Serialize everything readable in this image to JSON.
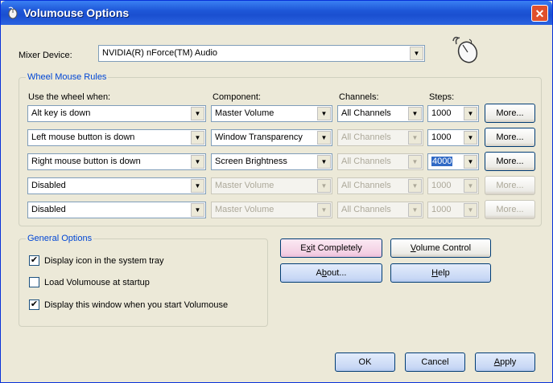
{
  "window": {
    "title": "Volumouse Options",
    "close_label": "✕"
  },
  "mixer": {
    "label": "Mixer Device:",
    "value": "NVIDIA(R) nForce(TM) Audio"
  },
  "rules": {
    "group_title": "Wheel Mouse Rules",
    "headers": {
      "when": "Use the wheel when:",
      "component": "Component:",
      "channels": "Channels:",
      "steps": "Steps:"
    },
    "rows": [
      {
        "when": "Alt key is down",
        "component": "Master Volume",
        "channels": "All Channels",
        "steps": "1000",
        "more": "More..."
      },
      {
        "when": "Left mouse button is down",
        "component": "Window Transparency",
        "channels": "All Channels",
        "steps": "1000",
        "more": "More..."
      },
      {
        "when": "Right mouse button is down",
        "component": "Screen Brightness",
        "channels": "All Channels",
        "steps": "4000",
        "more": "More..."
      },
      {
        "when": "Disabled",
        "component": "Master Volume",
        "channels": "All Channels",
        "steps": "1000",
        "more": "More..."
      },
      {
        "when": "Disabled",
        "component": "Master Volume",
        "channels": "All Channels",
        "steps": "1000",
        "more": "More..."
      }
    ]
  },
  "general": {
    "group_title": "General Options",
    "options": [
      {
        "label": "Display icon in the system tray",
        "checked": true
      },
      {
        "label": "Load Volumouse at startup",
        "checked": false
      },
      {
        "label": "Display this window when you start Volumouse",
        "checked": true
      }
    ]
  },
  "actions": {
    "exit_pre": "E",
    "exit_u": "x",
    "exit_post": "it Completely",
    "volume_u": "V",
    "volume_post": "olume Control",
    "about_pre": "A",
    "about_u": "b",
    "about_post": "out...",
    "help_u": "H",
    "help_post": "elp"
  },
  "footer": {
    "ok": "OK",
    "cancel": "Cancel",
    "apply_u": "A",
    "apply_post": "pply"
  },
  "check_glyph": "✔",
  "dropdown_glyph": "▼"
}
